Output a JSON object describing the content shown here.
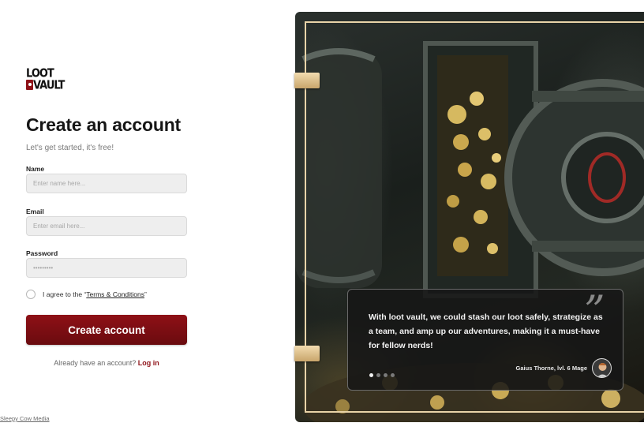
{
  "brand": {
    "logo_line1": "LOOT",
    "logo_line2": "VAULT"
  },
  "form": {
    "title": "Create an account",
    "subtitle": "Let's get started, it's free!",
    "name_label": "Name",
    "name_placeholder": "Enter name here...",
    "name_value": "",
    "email_label": "Email",
    "email_placeholder": "Enter email here...",
    "email_value": "",
    "password_label": "Password",
    "password_placeholder": "•••••••••",
    "password_value": "",
    "agree_prefix": "I agree to the “",
    "terms_link": "Terms & Conditions",
    "agree_suffix": "”",
    "agree_checked": false,
    "submit_label": "Create account",
    "login_prompt": "Already have an account?",
    "login_link": "Log in"
  },
  "testimonial": {
    "quote_mark": "”",
    "text": "With loot vault, we could stash our loot safely, strategize as a team, and amp up our  adventures, making it a must-have for fellow nerds!",
    "author": "Gaius Thorne, lvl. 6 Mage",
    "carousel_total": 4,
    "carousel_active": 1
  },
  "footer": {
    "credit": "Sleepy Cow Media"
  },
  "colors": {
    "accent": "#8f1218",
    "frame": "#e8d3a8",
    "input_bg": "#eeeeee"
  },
  "icons": {
    "logo_mark": "lock-icon",
    "avatar": "user-avatar"
  }
}
